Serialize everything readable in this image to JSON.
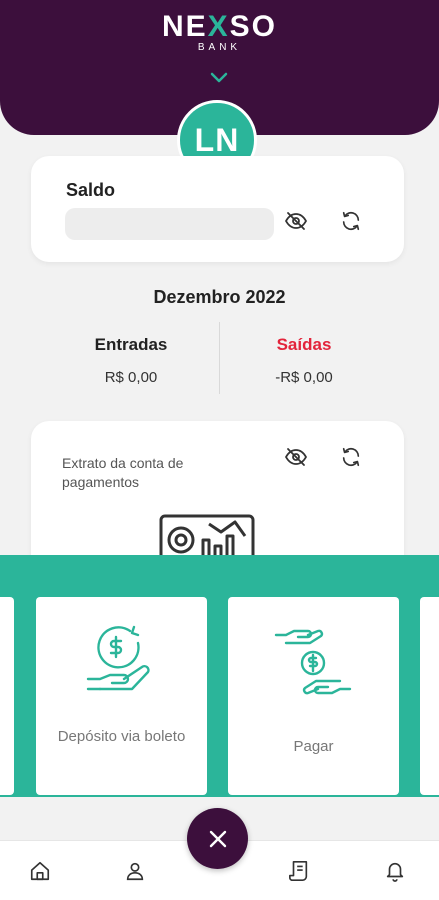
{
  "brand": {
    "logo_left": "NE",
    "logo_x": "X",
    "logo_right": "SO",
    "logo_sub": "BANK"
  },
  "colors": {
    "header_bg": "#3c0f3c",
    "accent": "#2bb59a",
    "saidas_red": "#e3243b"
  },
  "user": {
    "initials": "LN"
  },
  "balance_card": {
    "title": "Saldo",
    "hide_icon": "eye-off-icon",
    "refresh_icon": "refresh-icon"
  },
  "summary": {
    "month": "Dezembro 2022",
    "income_label": "Entradas",
    "income_value": "R$ 0,00",
    "expense_label": "Saídas",
    "expense_value": "-R$ 0,00"
  },
  "statement_card": {
    "title": "Extrato da conta de pagamentos",
    "hide_icon": "eye-off-icon",
    "refresh_icon": "refresh-icon",
    "illustration_icon": "chart-report-icon"
  },
  "quick_actions": [
    {
      "label": "Depósito via boleto",
      "icon": "money-hand-icon"
    },
    {
      "label": "Pagar",
      "icon": "exchange-money-icon"
    }
  ],
  "bottom_nav": [
    {
      "name": "home",
      "icon": "home-icon"
    },
    {
      "name": "profile",
      "icon": "user-icon"
    },
    {
      "name": "statement",
      "icon": "receipt-icon"
    },
    {
      "name": "notifications",
      "icon": "bell-icon"
    }
  ],
  "fab": {
    "icon": "close-icon"
  }
}
